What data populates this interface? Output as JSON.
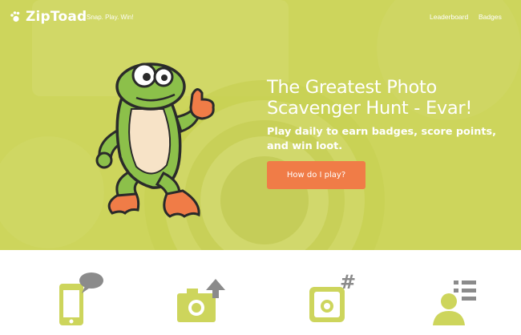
{
  "nav": {
    "logo_text": "ZipToad",
    "tagline": "Snap. Play. Win!",
    "links": [
      "Leaderboard",
      "Badges"
    ]
  },
  "hero": {
    "headline": "The Greatest Photo Scavenger Hunt - Evar!",
    "subhead": "Play daily to earn badges, score points, and win loot.",
    "cta_label": "How do I play?"
  },
  "features": [
    {
      "icon": "phone-chat-icon"
    },
    {
      "icon": "camera-upload-icon"
    },
    {
      "icon": "instagram-hashtag-icon"
    },
    {
      "icon": "user-list-icon"
    }
  ],
  "colors": {
    "hero_background": "#cdd55c",
    "cta": "#f07c47",
    "feature_icon": "#cdd55c",
    "feature_icon_accent": "#8b8b8b",
    "text_light": "#ffffff"
  }
}
